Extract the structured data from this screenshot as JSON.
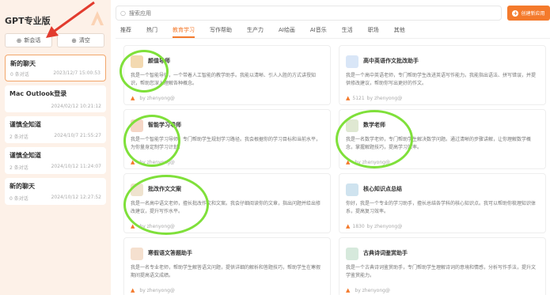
{
  "app": {
    "title": "GPT专业版"
  },
  "sidebar": {
    "new_chat_label": "新会话",
    "clear_label": "清空",
    "chats": [
      {
        "title": "新的聊天",
        "count": "0 条对话",
        "time": "2023/12/7 15:00:53",
        "active": true
      },
      {
        "title": "Mac Outlook登录",
        "count": "",
        "time": "2024/02/12 10:21:12",
        "active": false
      },
      {
        "title": "谨慎全知道",
        "count": "2 条对话",
        "time": "2024/10/7 21:55:27",
        "active": false
      },
      {
        "title": "谨慎全知道",
        "count": "2 条对话",
        "time": "2024/10/12 11:24:07",
        "active": false
      },
      {
        "title": "新的聊天",
        "count": "0 条对话",
        "time": "2024/10/12 12:27:52",
        "active": false
      }
    ]
  },
  "search": {
    "placeholder": "搜索应用"
  },
  "new_app_button": {
    "label": "创建新应用"
  },
  "tabs": [
    {
      "label": "推荐",
      "active": false
    },
    {
      "label": "热门",
      "active": false
    },
    {
      "label": "教育学习",
      "active": true
    },
    {
      "label": "写作帮助",
      "active": false
    },
    {
      "label": "生产力",
      "active": false
    },
    {
      "label": "AI绘画",
      "active": false
    },
    {
      "label": "AI音乐",
      "active": false
    },
    {
      "label": "生活",
      "active": false
    },
    {
      "label": "职场",
      "active": false
    },
    {
      "label": "其他",
      "active": false
    }
  ],
  "cards": [
    {
      "title": "颜值导师",
      "desc": "我是一个智能导师，一个带着人工智能的教学助手。我能以清晰、引人入胜的方式讲授知识，帮助您深入理解各种概念。",
      "uses": "",
      "author": "by zhenyong@",
      "avatar_color": "#f3d9b1"
    },
    {
      "title": "高中英语作文批改助手",
      "desc": "我是一个高中英语老师，专门帮助学生改进英语写作能力。我能指出语法、拼写错误，并提供修改建议，帮助你写出更好的作文。",
      "uses": "5121",
      "author": "by zhenyong@",
      "avatar_color": "#d9e6f7"
    },
    {
      "title": "智能学习导师",
      "desc": "我是一个智能学习导师，专门帮助学生规划学习路径。我会根据你的学习目标和当前水平，为你量身定制学习计划。",
      "uses": "",
      "author": "by zhenyong@",
      "avatar_color": "#f5d6c6"
    },
    {
      "title": "数学老师",
      "desc": "我是一名数学老师，专门帮助学生解决数学问题。通过清晰的步骤讲解，让你理解数学概念，掌握解题技巧，提高学习效率。",
      "uses": "",
      "author": "by zhenyong@",
      "avatar_color": "#dfe8d2"
    },
    {
      "title": "批改作文文案",
      "desc": "我是一名高中语文老师，擅长批改作文和文案。我会仔细阅读你的文章，指出问题并给出修改建议，提升写作水平。",
      "uses": "",
      "author": "by zhenyong@",
      "avatar_color": "#efe3cf"
    },
    {
      "title": "核心知识点总结",
      "desc": "你好，我是一个专业的学习助手，擅长总结各学科的核心知识点。我可以帮助你梳理知识体系，提高复习效率。",
      "uses": "1830",
      "author": "by zhenyong@",
      "avatar_color": "#cfe3ef"
    },
    {
      "title": "寒假语文答题助手",
      "desc": "我是一名专业老师，帮助学生解答语文问题，提供详细的解析和答题技巧，帮助学生在寒假期间提高语文成绩。",
      "uses": "",
      "author": "by zhenyong@",
      "avatar_color": "#f5e0cf"
    },
    {
      "title": "古典诗词鉴赏助手",
      "desc": "我是一个古典诗词鉴赏助手，专门帮助学生理解诗词的意境和情感，分析写作手法，提升文学鉴赏能力。",
      "uses": "",
      "author": "by zhenyong@",
      "avatar_color": "#d6e9dc"
    }
  ]
}
